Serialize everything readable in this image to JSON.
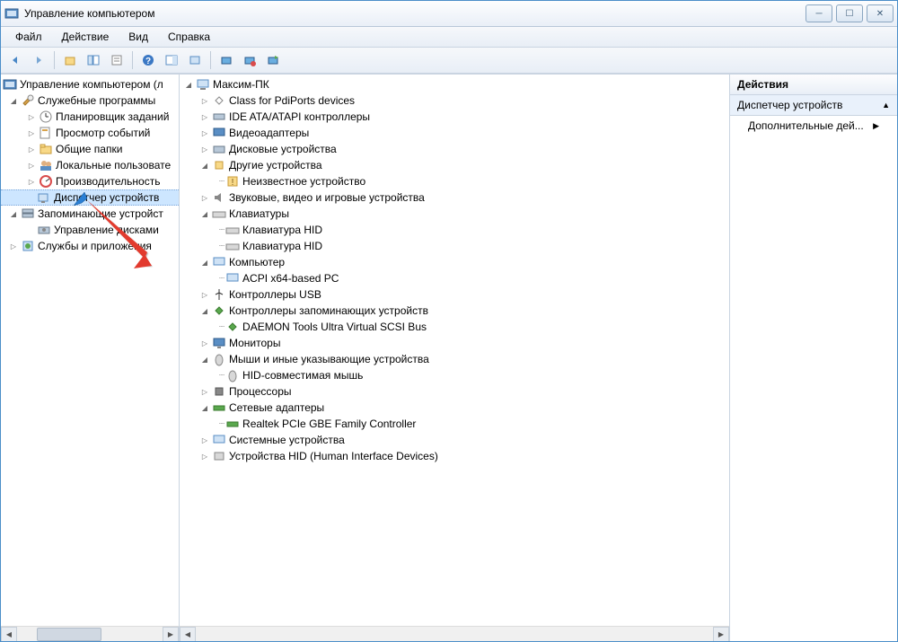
{
  "window": {
    "title": "Управление компьютером"
  },
  "menu": {
    "file": "Файл",
    "action": "Действие",
    "view": "Вид",
    "help": "Справка"
  },
  "leftTree": {
    "root": "Управление компьютером (л",
    "group1": "Служебные программы",
    "scheduler": "Планировщик заданий",
    "eventviewer": "Просмотр событий",
    "sharedfolders": "Общие папки",
    "localusers": "Локальные пользовате",
    "performance": "Производительность",
    "devicemgr": "Диспетчер устройств",
    "group2": "Запоминающие устройст",
    "diskmgmt": "Управление дисками",
    "group3": "Службы и приложения"
  },
  "centerTree": {
    "root": "Максим-ПК",
    "pdiports": "Class for PdiPorts devices",
    "ide": "IDE ATA/ATAPI контроллеры",
    "video": "Видеоадаптеры",
    "disk": "Дисковые устройства",
    "other": "Другие устройства",
    "unknown": "Неизвестное устройство",
    "sound": "Звуковые, видео и игровые устройства",
    "keyboards": "Клавиатуры",
    "kbdhid1": "Клавиатура HID",
    "kbdhid2": "Клавиатура HID",
    "computer": "Компьютер",
    "acpi": "ACPI x64-based PC",
    "usb": "Контроллеры USB",
    "storagectrl": "Контроллеры запоминающих устройств",
    "daemon": "DAEMON Tools Ultra Virtual SCSI Bus",
    "monitors": "Мониторы",
    "mice": "Мыши и иные указывающие устройства",
    "hidmouse": "HID-совместимая мышь",
    "processors": "Процессоры",
    "netadapters": "Сетевые адаптеры",
    "realtek": "Realtek PCIe GBE Family Controller",
    "sysdevices": "Системные устройства",
    "hiddevices": "Устройства HID (Human Interface Devices)"
  },
  "actions": {
    "header": "Действия",
    "context": "Диспетчер устройств",
    "more": "Дополнительные дей..."
  }
}
